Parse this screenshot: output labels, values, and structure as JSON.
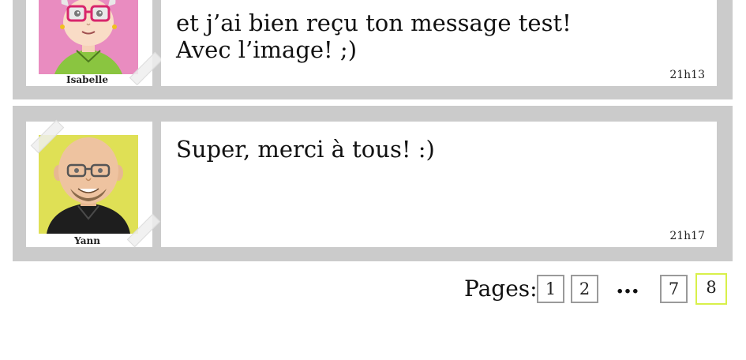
{
  "messages": [
    {
      "author": "Isabelle",
      "text": "et j’ai bien reçu ton message test!\nAvec l’image! ;)",
      "time": "21h13",
      "avatar_bg": "#e98cc0"
    },
    {
      "author": "Yann",
      "text": "Super, merci à tous! :)",
      "time": "21h17",
      "avatar_bg": "#dfe055"
    }
  ],
  "pagination": {
    "label": "Pages:",
    "pages": [
      "1",
      "2",
      "7",
      "8"
    ],
    "ellipsis": "…",
    "current": "8"
  },
  "colors": {
    "message_frame": "#cbcbcb",
    "current_page_border": "#d8f04a",
    "page_border": "#9a9a9a"
  }
}
